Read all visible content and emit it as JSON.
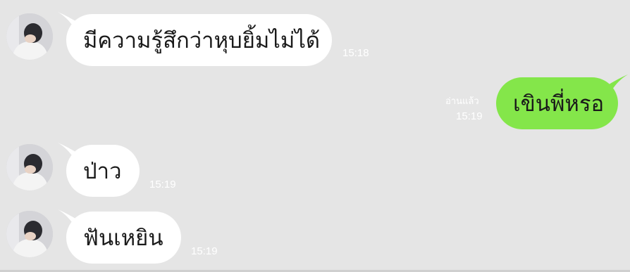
{
  "chat": {
    "messages": [
      {
        "side": "incoming",
        "text": "มีความรู้สึกว่าหุบยิ้มไม่ได้",
        "time": "15:18"
      },
      {
        "side": "outgoing",
        "text": "เขินพี่หรอ",
        "time": "15:19",
        "read_label": "อ่านแล้ว"
      },
      {
        "side": "incoming",
        "text": "ป่าว",
        "time": "15:19"
      },
      {
        "side": "incoming",
        "text": "ฟันเหยิน",
        "time": "15:19"
      }
    ]
  },
  "colors": {
    "background": "#e5e5e5",
    "incoming_bubble": "#ffffff",
    "outgoing_bubble": "#84e64a",
    "timestamp": "#ffffff"
  },
  "icons": {
    "avatar": "contact-avatar-photo"
  }
}
